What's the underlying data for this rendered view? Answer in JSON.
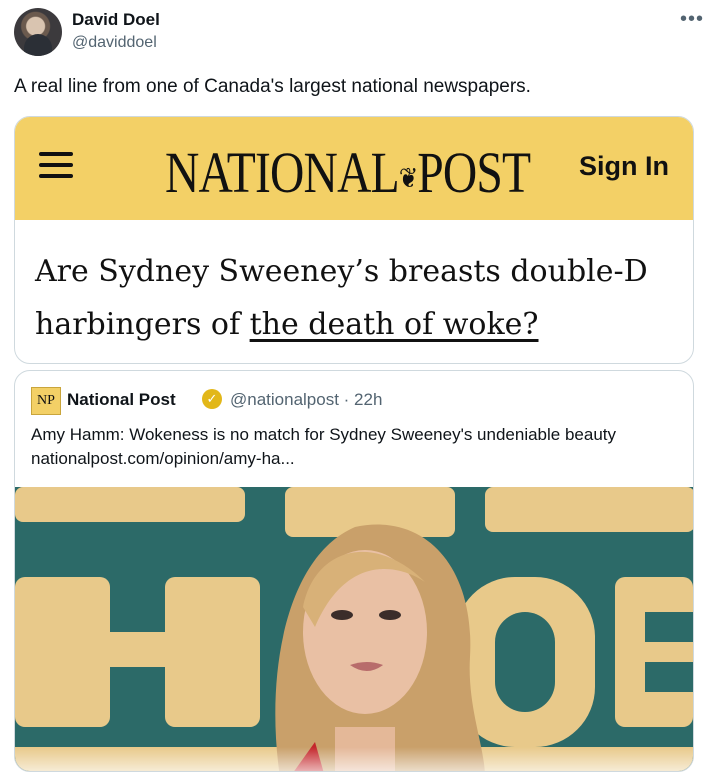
{
  "tweet": {
    "display_name": "David Doel",
    "handle": "@daviddoel",
    "text": "A real line from one of Canada's largest national newspapers.",
    "more_icon": "more-horizontal-icon"
  },
  "screenshot_card": {
    "masthead_left": "NATIONAL",
    "masthead_right": "POST",
    "sign_in": "Sign In",
    "headline_plain": "Are Sydney Sweeney’s breasts double-D harbingers of ",
    "headline_underlined": "the death of woke?",
    "colors": {
      "bar": "#f3d066"
    }
  },
  "quoted_tweet": {
    "logo_text": "NP",
    "name": "National Post",
    "handle_time": "@nationalpost · 22h",
    "text_line1": "Amy Hamm: Wokeness is no match for Sydney Sweeney's undeniable beauty",
    "text_line2": "nationalpost.com/opinion/amy-ha..."
  }
}
